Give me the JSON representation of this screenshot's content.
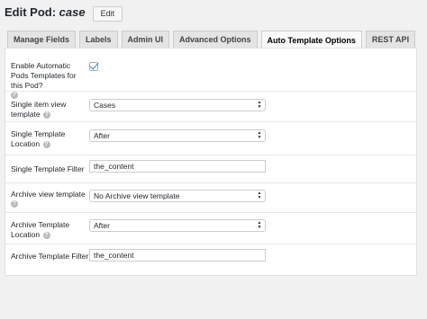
{
  "header": {
    "title_prefix": "Edit Pod:",
    "pod_name": "case",
    "edit_label": "Edit"
  },
  "tabs": [
    {
      "label": "Manage Fields",
      "active": false
    },
    {
      "label": "Labels",
      "active": false
    },
    {
      "label": "Admin UI",
      "active": false
    },
    {
      "label": "Advanced Options",
      "active": false
    },
    {
      "label": "Auto Template Options",
      "active": true
    },
    {
      "label": "REST API",
      "active": false
    }
  ],
  "form": {
    "enable_auto": {
      "label": "Enable Automatic Pods Templates for this Pod?",
      "checked": true
    },
    "single_item_template": {
      "label": "Single item view template",
      "value": "Cases"
    },
    "single_template_location": {
      "label": "Single Template Location",
      "value": "After"
    },
    "single_template_filter": {
      "label": "Single Template Filter",
      "value": "the_content"
    },
    "archive_view_template": {
      "label": "Archive view template",
      "value": "No Archive view template"
    },
    "archive_template_location": {
      "label": "Archive Template Location",
      "value": "After"
    },
    "archive_template_filter": {
      "label": "Archive Template Filter",
      "value": "the_content"
    }
  },
  "help_icon_glyph": "?"
}
